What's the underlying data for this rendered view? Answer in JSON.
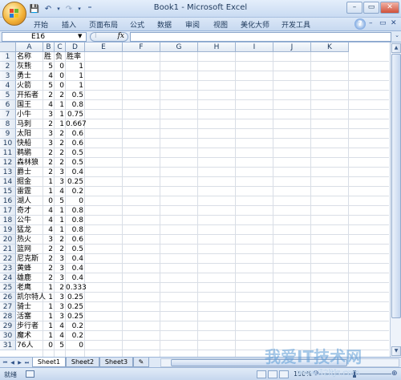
{
  "app": {
    "title": "Book1 - Microsoft Excel",
    "window_controls": [
      "–",
      "▭",
      "✕"
    ]
  },
  "qat": {
    "save_icon": "💾",
    "undo_icon": "↶",
    "undo_drop": "▾",
    "redo_icon": "↷",
    "redo_drop": "▾",
    "customize_icon": "⁼"
  },
  "ribbon": {
    "tabs": [
      "开始",
      "插入",
      "页面布局",
      "公式",
      "数据",
      "审阅",
      "视图",
      "美化大师",
      "开发工具"
    ],
    "help": "?",
    "minimize": "–",
    "restore": "▭",
    "close": "✕"
  },
  "formula_bar": {
    "cell_ref": "E16",
    "fx_label": "fx",
    "value": ""
  },
  "grid": {
    "columns": [
      "A",
      "B",
      "C",
      "D",
      "E",
      "F",
      "G",
      "H",
      "I",
      "J",
      "K"
    ],
    "rows": [
      [
        "名称",
        "胜",
        "负",
        "胜率"
      ],
      [
        "灰熊",
        "5",
        "0",
        "1"
      ],
      [
        "勇士",
        "4",
        "0",
        "1"
      ],
      [
        "火箭",
        "5",
        "0",
        "1"
      ],
      [
        "开拓者",
        "2",
        "2",
        "0.5"
      ],
      [
        "国王",
        "4",
        "1",
        "0.8"
      ],
      [
        "小牛",
        "3",
        "1",
        "0.75"
      ],
      [
        "马刺",
        "2",
        "1",
        "0.667"
      ],
      [
        "太阳",
        "3",
        "2",
        "0.6"
      ],
      [
        "快船",
        "3",
        "2",
        "0.6"
      ],
      [
        "鹈鹕",
        "2",
        "2",
        "0.5"
      ],
      [
        "森林狼",
        "2",
        "2",
        "0.5"
      ],
      [
        "爵士",
        "2",
        "3",
        "0.4"
      ],
      [
        "掘金",
        "1",
        "3",
        "0.25"
      ],
      [
        "雷霆",
        "1",
        "4",
        "0.2"
      ],
      [
        "湖人",
        "0",
        "5",
        "0"
      ],
      [
        "奇才",
        "4",
        "1",
        "0.8"
      ],
      [
        "公牛",
        "4",
        "1",
        "0.8"
      ],
      [
        "猛龙",
        "4",
        "1",
        "0.8"
      ],
      [
        "热火",
        "3",
        "2",
        "0.6"
      ],
      [
        "篮网",
        "2",
        "2",
        "0.5"
      ],
      [
        "尼克斯",
        "2",
        "3",
        "0.4"
      ],
      [
        "黄蜂",
        "2",
        "3",
        "0.4"
      ],
      [
        "雄鹿",
        "2",
        "3",
        "0.4"
      ],
      [
        "老鹰",
        "1",
        "2",
        "0.333"
      ],
      [
        "凯尔特人",
        "1",
        "3",
        "0.25"
      ],
      [
        "骑士",
        "1",
        "3",
        "0.25"
      ],
      [
        "活塞",
        "1",
        "3",
        "0.25"
      ],
      [
        "步行者",
        "1",
        "4",
        "0.2"
      ],
      [
        "魔术",
        "1",
        "4",
        "0.2"
      ],
      [
        "76人",
        "0",
        "5",
        "0"
      ]
    ]
  },
  "sheets": {
    "tabs": [
      "Sheet1",
      "Sheet2",
      "Sheet3"
    ],
    "active": "Sheet1",
    "nav": [
      "⏮",
      "◀",
      "▶",
      "⏭"
    ]
  },
  "status": {
    "ready": "就绪",
    "zoom": "100%",
    "zoom_minus": "⊖",
    "zoom_plus": "⊕",
    "zoom_level_percent": 100
  },
  "watermark": {
    "text": "我爱IT技术网",
    "url": "www.52itjs.com"
  }
}
